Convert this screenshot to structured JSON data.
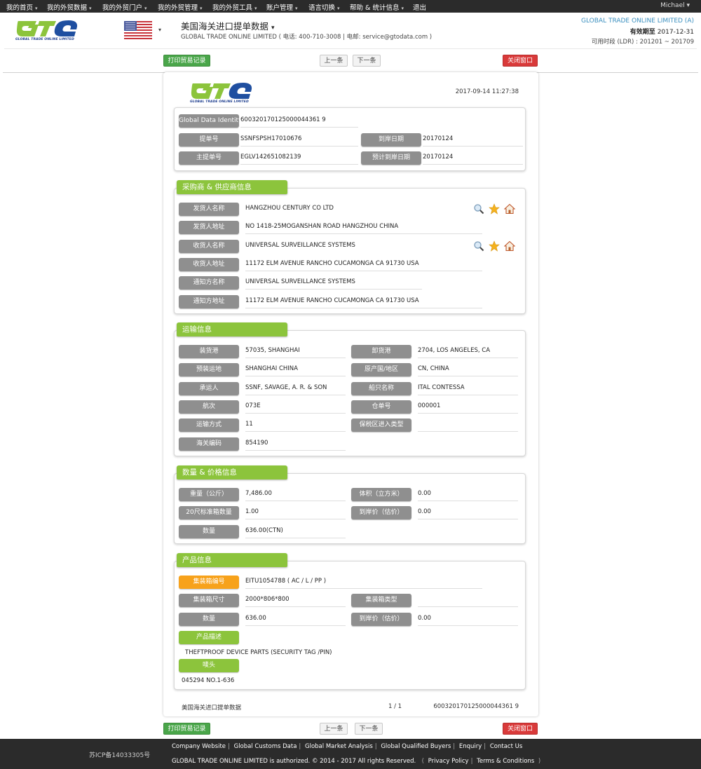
{
  "topnav": {
    "items": [
      {
        "label": "我的首页",
        "has_caret": true
      },
      {
        "label": "我的外贸数据",
        "has_caret": true
      },
      {
        "label": "我的外贸门户",
        "has_caret": true
      },
      {
        "label": "我的外贸管理",
        "has_caret": true
      },
      {
        "label": "我的外贸工具",
        "has_caret": true
      },
      {
        "label": "账户管理",
        "has_caret": true
      },
      {
        "label": "语言切换",
        "has_caret": true
      },
      {
        "label": "帮助 & 统计信息",
        "has_caret": true
      },
      {
        "label": "退出",
        "has_caret": false
      }
    ],
    "caret": "▾",
    "user": "Michael ▾"
  },
  "header": {
    "logo_text": "GLOBAL TRADE ONLINE LIMITED",
    "country_icon": "us-flag-icon",
    "title": "美国海关进口提单数据",
    "title_caret": "▾",
    "subtitle": "GLOBAL TRADE ONLINE LIMITED ( 电话:  400-710-3008  | 电邮:  service@gtodata.com )",
    "company": "GLOBAL TRADE ONLINE LIMITED (A)",
    "expiry_label": "有效期至",
    "expiry_value": "2017-12-31",
    "ldr": "可用时段 (LDR) : 201201 ~ 201709",
    "colors": {
      "logo_green": "#8cc43c",
      "logo_blue": "#1f4fa0",
      "company_blue": "#3a8fbf"
    }
  },
  "actions": {
    "print": "打印贸易记录",
    "prev": "上一条",
    "next": "下一条",
    "close": "关闭窗口"
  },
  "record": {
    "datetime": "2017-09-14 11:27:38",
    "id_block": {
      "gdi_label": "Global Data Identity",
      "gdi_value": "600320170125000044361 9",
      "bol_label": "提单号",
      "bol_value": "SSNFSPSH17010676",
      "arrival_label": "到岸日期",
      "arrival_value": "20170124",
      "master_bol_label": "主提单号",
      "master_bol_value": "EGLV142651082139",
      "est_arrival_label": "预计到岸日期",
      "est_arrival_value": "20170124"
    },
    "parties": {
      "title": "采购商 & 供应商信息",
      "shipper_name_label": "发货人名称",
      "shipper_name": "HANGZHOU CENTURY CO LTD",
      "shipper_addr_label": "发货人地址",
      "shipper_addr": " NO 1418-25MOGANSHAN ROAD HANGZHOU CHINA",
      "consignee_name_label": "收货人名称",
      "consignee_name": "UNIVERSAL SURVEILLANCE SYSTEMS",
      "consignee_addr_label": "收货人地址",
      "consignee_addr": "11172 ELM AVENUE RANCHO CUCAMONGA CA 91730 USA",
      "notify_name_label": "通知方名称",
      "notify_name": "UNIVERSAL SURVEILLANCE SYSTEMS",
      "notify_addr_label": "通知方地址",
      "notify_addr": "11172 ELM AVENUE RANCHO CUCAMONGA CA 91730 USA"
    },
    "transport": {
      "title": "运输信息",
      "rows": [
        {
          "l1": "装货港",
          "v1": "57035, SHANGHAI",
          "l2": "卸货港",
          "v2": "2704, LOS ANGELES, CA"
        },
        {
          "l1": "预装运地",
          "v1": "SHANGHAI CHINA",
          "l2": "原产国/地区",
          "v2": "CN, CHINA"
        },
        {
          "l1": "承运人",
          "v1": "SSNF, SAVAGE, A. R. & SON",
          "l2": "船只名称",
          "v2": "ITAL CONTESSA"
        },
        {
          "l1": "航次",
          "v1": "073E",
          "l2": "仓单号",
          "v2": "000001"
        },
        {
          "l1": "运输方式",
          "v1": "11",
          "l2": "保税区进入类型",
          "v2": ""
        },
        {
          "l1": "海关编码",
          "v1": "854190"
        }
      ]
    },
    "quantity": {
      "title": "数量 & 价格信息",
      "rows": [
        {
          "l1": "重量（公斤）",
          "v1": "7,486.00",
          "l2": "体积（立方米）",
          "v2": "0.00"
        },
        {
          "l1": "20尺标准箱数量",
          "v1": "1.00",
          "l2": "到岸价（估价）",
          "v2": "0.00"
        },
        {
          "l1": "数量",
          "v1": "636.00(CTN)"
        }
      ]
    },
    "product": {
      "title": "产品信息",
      "container_no_label": "集装箱编号",
      "container_no": "EITU1054788 ( AC / L / PP )",
      "container_size_label": "集装箱尺寸",
      "container_size": "2000*806*800",
      "container_type_label": "集装箱类型",
      "container_type": "",
      "qty_label": "数量",
      "qty": "636.00",
      "cif_label": "到岸价（估价）",
      "cif": "0.00",
      "desc_label": "产品描述",
      "desc": "THEFTPROOF DEVICE PARTS (SECURITY TAG /PIN)",
      "marks_label": "唛头",
      "marks": "045294 NO.1-636"
    },
    "footer": {
      "source": "美国海关进口提单数据",
      "page": "1 / 1",
      "id": "600320170125000044361 9"
    }
  },
  "footer": {
    "icp": "苏ICP备14033305号",
    "links": [
      "Company Website",
      "Global Customs Data",
      "Global Market Analysis",
      "Global Qualified Buyers",
      "Enquiry",
      "Contact Us"
    ],
    "copyright": "GLOBAL TRADE ONLINE LIMITED is authorized. © 2014 - 2017 All rights Reserved.",
    "privacy": "Privacy Policy",
    "terms": "Terms & Conditions"
  }
}
